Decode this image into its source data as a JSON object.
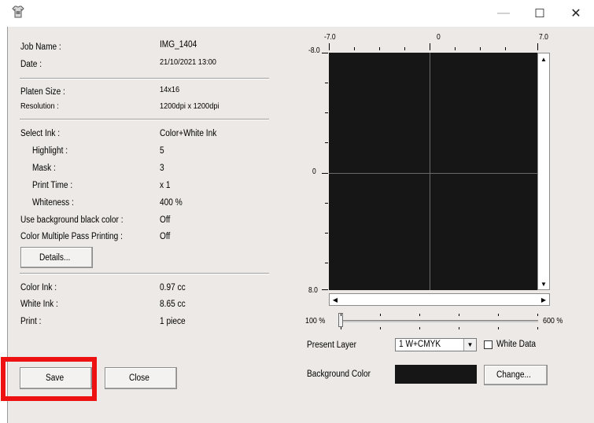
{
  "window": {
    "minimize_glyph": "—",
    "maximize_glyph": "☐",
    "close_glyph": "✕"
  },
  "job_info": {
    "job_name_label": "Job Name :",
    "job_name_value": "IMG_1404",
    "date_label": "Date :",
    "date_value": "21/10/2021 13:00",
    "platen_size_label": "Platen Size :",
    "platen_size_value": "14x16",
    "resolution_label": "Resolution :",
    "resolution_value": "1200dpi x 1200dpi"
  },
  "ink_settings": {
    "select_ink_label": "Select Ink :",
    "select_ink_value": "Color+White Ink",
    "highlight_label": "Highlight :",
    "highlight_value": "5",
    "mask_label": "Mask :",
    "mask_value": "3",
    "print_time_label": "Print Time :",
    "print_time_value": "x 1",
    "whiteness_label": "Whiteness :",
    "whiteness_value": "400 %",
    "bg_black_label": "Use background black color :",
    "bg_black_value": "Off",
    "multipass_label": "Color Multiple Pass Printing :",
    "multipass_value": "Off",
    "details_button": "Details..."
  },
  "usage": {
    "color_ink_label": "Color Ink :",
    "color_ink_value": "0.97 cc",
    "white_ink_label": "White Ink :",
    "white_ink_value": "8.65 cc",
    "print_label": "Print :",
    "print_value": "1 piece"
  },
  "buttons": {
    "save": "Save",
    "close": "Close"
  },
  "preview": {
    "x_min": "-7.0",
    "x_mid": "0",
    "x_max": "7.0",
    "y_min": "-8.0",
    "y_mid": "0",
    "y_max": "8.0",
    "zoom_min": "100 %",
    "zoom_max": "600 %",
    "zoom_value": 0
  },
  "layer": {
    "present_layer_label": "Present Layer",
    "present_layer_value": "1  W+CMYK",
    "white_data_label": "White Data",
    "background_color_label": "Background Color",
    "background_color": "#161616",
    "change_button": "Change..."
  },
  "colors": {
    "highlight_box": "#ee1111",
    "dialog_bg": "#ece9e6"
  }
}
